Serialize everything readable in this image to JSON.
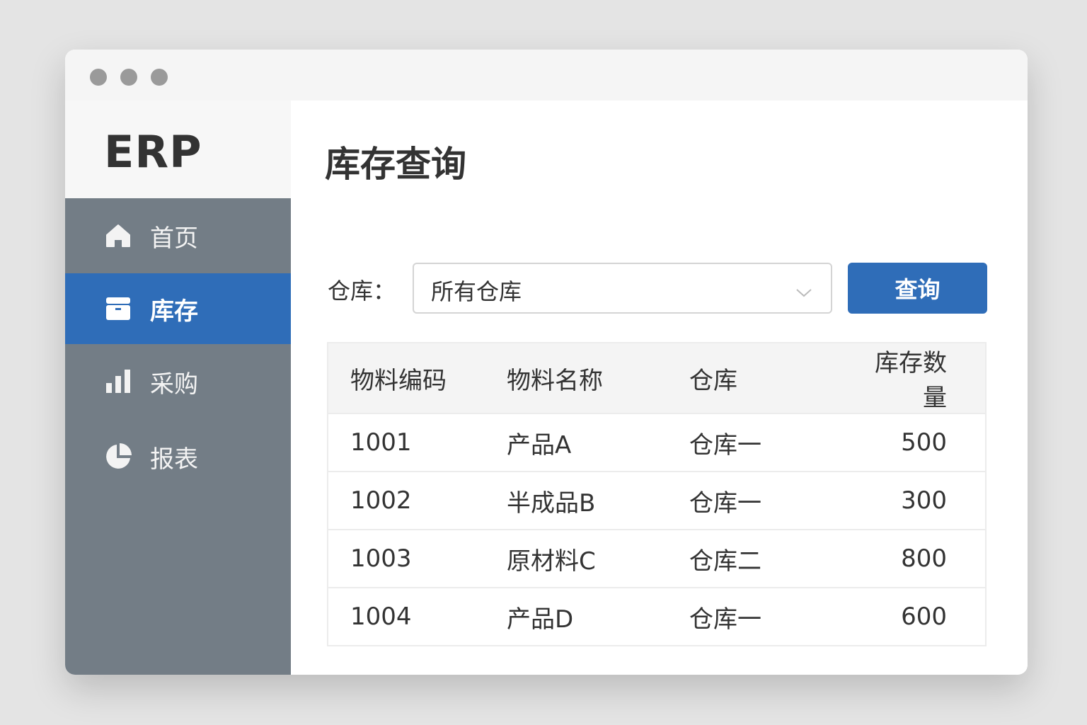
{
  "sidebar": {
    "logo": "ERP",
    "items": [
      {
        "label": "首页",
        "icon": "home-icon"
      },
      {
        "label": "库存",
        "icon": "archive-box-icon",
        "active": true
      },
      {
        "label": "采购",
        "icon": "bar-chart-icon"
      },
      {
        "label": "报表",
        "icon": "pie-chart-icon"
      }
    ]
  },
  "main": {
    "title": "库存查询",
    "filter_label": "仓库：",
    "select_value": "所有仓库",
    "query_button": "查询"
  },
  "table": {
    "headers": [
      "物料编码",
      "物料名称",
      "仓库",
      "库存数量"
    ],
    "rows": [
      [
        "1001",
        "产品A",
        "仓库一",
        "500"
      ],
      [
        "1002",
        "半成品B",
        "仓库一",
        "300"
      ],
      [
        "1003",
        "原材料C",
        "仓库二",
        "800"
      ],
      [
        "1004",
        "产品D",
        "仓库一",
        "600"
      ]
    ]
  },
  "colors": {
    "accent": "#2f6db8",
    "sidebar": "#737d86"
  }
}
